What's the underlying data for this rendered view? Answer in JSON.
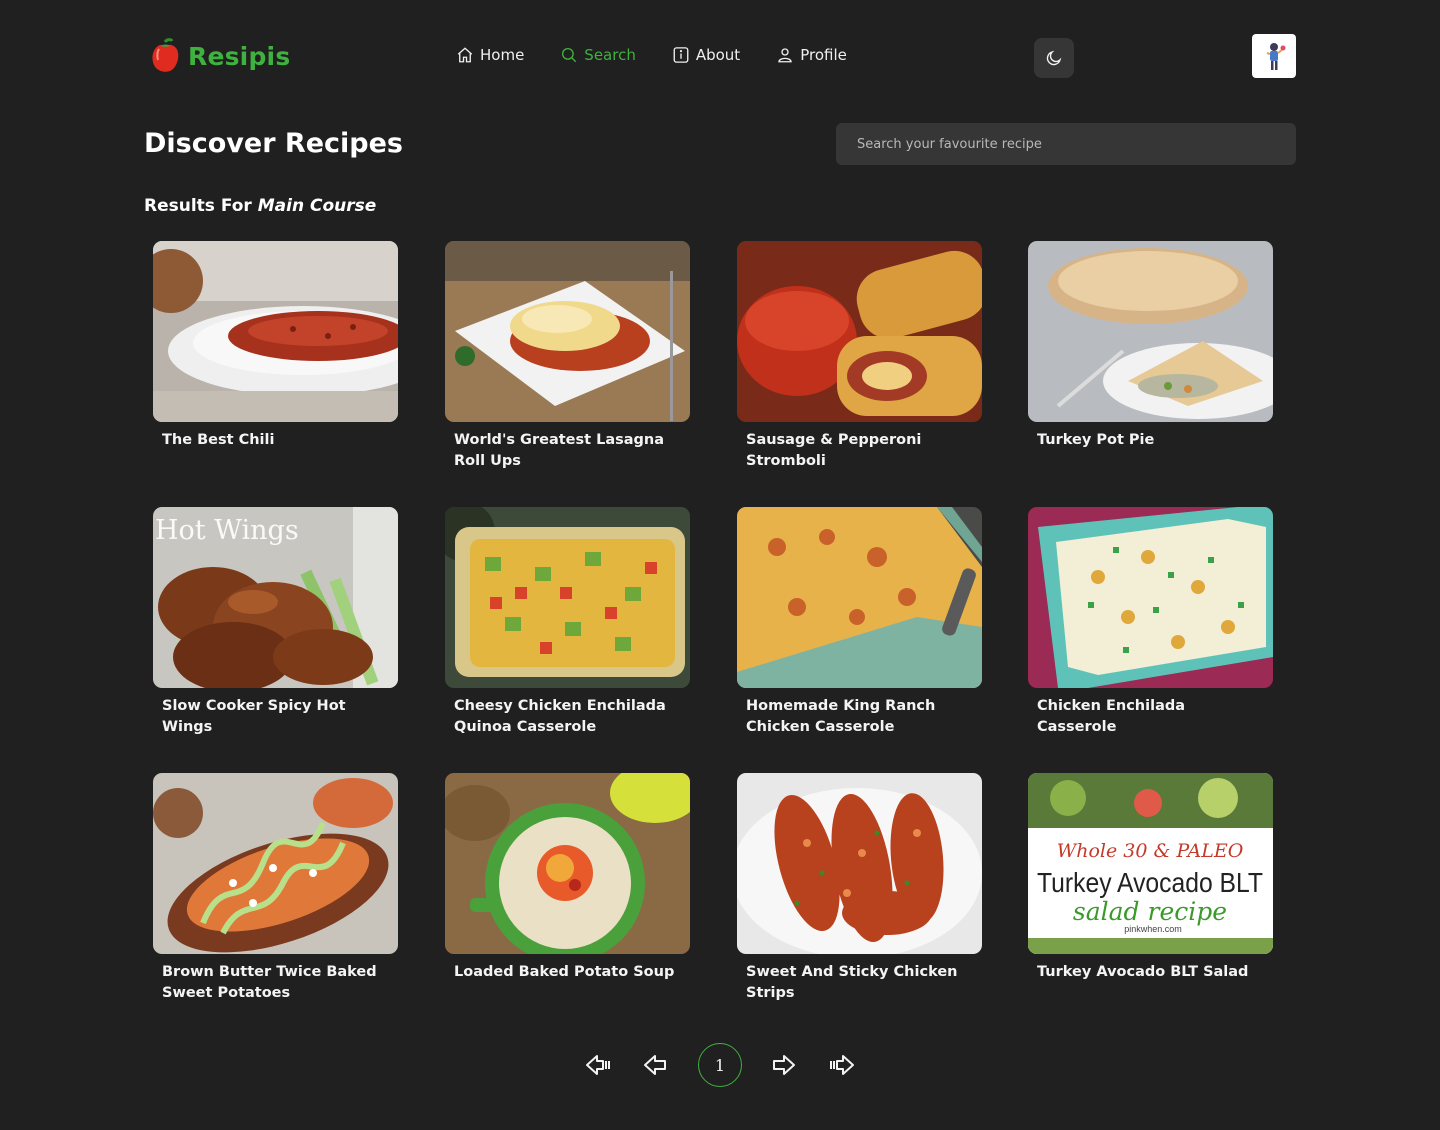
{
  "app": {
    "name": "Resipis"
  },
  "nav": {
    "home": "Home",
    "search": "Search",
    "about": "About",
    "profile": "Profile"
  },
  "page": {
    "title": "Discover Recipes",
    "results_prefix": "Results For",
    "results_query": "Main Course"
  },
  "search": {
    "placeholder": "Search your favourite recipe",
    "value": ""
  },
  "recipes": [
    {
      "title": "The Best Chili"
    },
    {
      "title": "World's Greatest Lasagna Roll Ups"
    },
    {
      "title": "Sausage & Pepperoni Stromboli"
    },
    {
      "title": "Turkey Pot Pie"
    },
    {
      "title": "Slow Cooker Spicy Hot Wings",
      "image_text": "Hot Wings"
    },
    {
      "title": "Cheesy Chicken Enchilada Quinoa Casserole"
    },
    {
      "title": "Homemade King Ranch Chicken Casserole"
    },
    {
      "title": "Chicken Enchilada Casserole"
    },
    {
      "title": "Brown Butter Twice Baked Sweet Potatoes"
    },
    {
      "title": "Loaded Baked Potato Soup"
    },
    {
      "title": "Sweet And Sticky Chicken Strips"
    },
    {
      "title": "Turkey Avocado BLT Salad",
      "image_text": [
        "Whole 30 & PALEO",
        "Turkey Avocado BLT",
        "salad recipe",
        "pinkwhen.com"
      ]
    }
  ],
  "pagination": {
    "current_page": "1"
  },
  "colors": {
    "accent": "#3fb13f",
    "background": "#202020",
    "surface": "#363636"
  },
  "icons": [
    "pepper-logo-icon",
    "home-icon",
    "search-icon",
    "info-icon",
    "user-icon",
    "moon-icon",
    "first-page-icon",
    "previous-page-icon",
    "next-page-icon",
    "last-page-icon"
  ]
}
